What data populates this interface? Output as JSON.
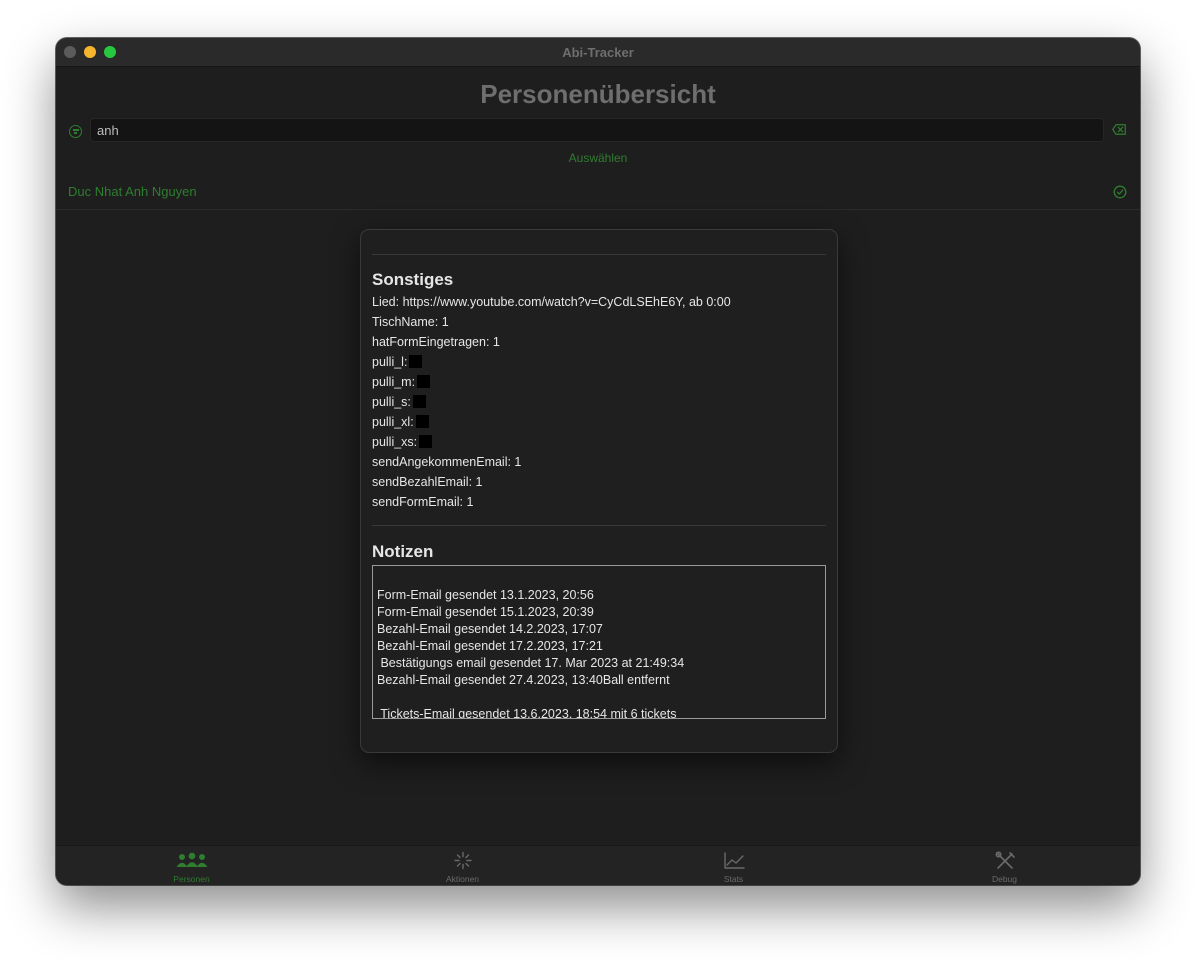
{
  "window": {
    "title": "Abi-Tracker"
  },
  "header": {
    "title": "Personenübersicht"
  },
  "search": {
    "value": "anh",
    "select_label": "Auswählen"
  },
  "people": [
    {
      "name": "Duc Nhat Anh Nguyen",
      "selected": true
    }
  ],
  "detail": {
    "section_sonstiges": "Sonstiges",
    "fields": [
      "Lied: https://www.youtube.com/watch?v=CyCdLSEhE6Y, ab 0:00",
      "TischName: 1",
      "hatFormEingetragen: 1",
      "pulli_l:",
      "pulli_m:",
      "pulli_s:",
      "pulli_xl:",
      "pulli_xs:",
      "sendAngekommenEmail: 1",
      "sendBezahlEmail: 1",
      "sendFormEmail: 1"
    ],
    "section_notizen": "Notizen",
    "notes": [
      "Form-Email gesendet 13.1.2023, 20:56",
      "Form-Email gesendet 15.1.2023, 20:39",
      "Bezahl-Email gesendet 14.2.2023, 17:07",
      "Bezahl-Email gesendet 17.2.2023, 17:21",
      " Bestätigungs email gesendet 17. Mar 2023 at 21:49:34",
      "Bezahl-Email gesendet 27.4.2023, 13:40Ball entfernt",
      " Tickets-Email gesendet 13.6.2023, 18:54 mit 6 tickets"
    ]
  },
  "tabs": [
    {
      "label": "Personen",
      "icon": "people-icon",
      "active": true
    },
    {
      "label": "Aktionen",
      "icon": "sparkle-icon",
      "active": false
    },
    {
      "label": "Stats",
      "icon": "chart-icon",
      "active": false
    },
    {
      "label": "Debug",
      "icon": "tools-icon",
      "active": false
    }
  ],
  "colors": {
    "accent": "#2f7d2f",
    "background": "#1e1e1e",
    "text": "#e6e6e6"
  }
}
